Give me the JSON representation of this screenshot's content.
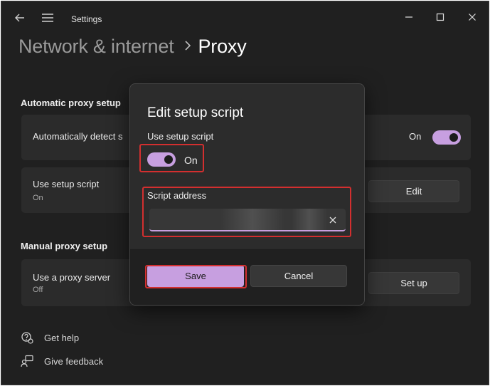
{
  "titlebar": {
    "title": "Settings"
  },
  "header": {
    "parent": "Network & internet",
    "current": "Proxy"
  },
  "automatic_section": {
    "title": "Automatic proxy setup",
    "detect": {
      "label": "Automatically detect s",
      "state": "On"
    },
    "script": {
      "label": "Use setup script",
      "sub": "On",
      "button": "Edit"
    }
  },
  "manual_section": {
    "title": "Manual proxy setup",
    "proxy": {
      "label": "Use a proxy server",
      "sub": "Off",
      "button": "Set up"
    }
  },
  "footer": {
    "help": "Get help",
    "feedback": "Give feedback"
  },
  "dialog": {
    "title": "Edit setup script",
    "toggle_label": "Use setup script",
    "toggle_state": "On",
    "address_label": "Script address",
    "address_value": "",
    "save": "Save",
    "cancel": "Cancel"
  },
  "colors": {
    "accent": "#c79fe0",
    "highlight": "#d32f2f",
    "background": "#202020",
    "card": "#2b2b2b"
  },
  "icons": [
    "back-arrow-icon",
    "hamburger-menu-icon",
    "minimize-icon",
    "maximize-icon",
    "close-icon",
    "chevron-right-icon",
    "clear-icon",
    "help-icon",
    "feedback-icon"
  ]
}
